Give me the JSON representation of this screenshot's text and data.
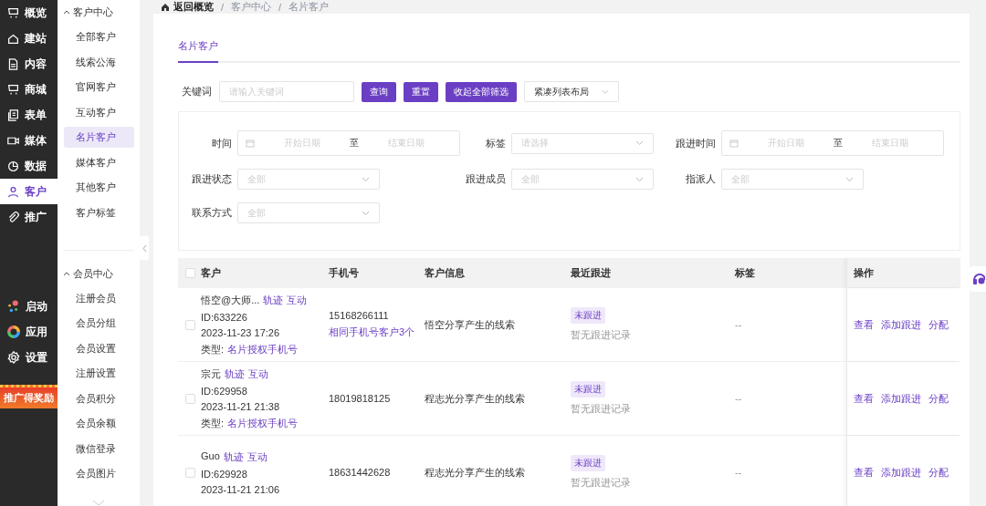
{
  "rail": {
    "items": [
      {
        "label": "概览",
        "selected": false
      },
      {
        "label": "建站",
        "selected": false
      },
      {
        "label": "内容",
        "selected": false
      },
      {
        "label": "商城",
        "selected": false
      },
      {
        "label": "表单",
        "selected": false
      },
      {
        "label": "媒体",
        "selected": false
      },
      {
        "label": "数据",
        "selected": false
      },
      {
        "label": "客户",
        "selected": true
      },
      {
        "label": "推广",
        "selected": false
      }
    ],
    "bottom_items": [
      "启动",
      "应用",
      "设置"
    ],
    "promo": "推广得奖励"
  },
  "subnav": {
    "groups": [
      {
        "title": "客户中心",
        "expanded": true,
        "items": [
          {
            "label": "全部客户",
            "selected": false
          },
          {
            "label": "线索公海",
            "selected": false
          },
          {
            "label": "官网客户",
            "selected": false
          },
          {
            "label": "互动客户",
            "selected": false
          },
          {
            "label": "名片客户",
            "selected": true
          },
          {
            "label": "媒体客户",
            "selected": false
          },
          {
            "label": "其他客户",
            "selected": false
          },
          {
            "label": "客户标签",
            "selected": false
          }
        ]
      },
      {
        "title": "会员中心",
        "expanded": true,
        "items": [
          {
            "label": "注册会员",
            "selected": false
          },
          {
            "label": "会员分组",
            "selected": false
          },
          {
            "label": "会员设置",
            "selected": false
          },
          {
            "label": "注册设置",
            "selected": false
          },
          {
            "label": "会员积分",
            "selected": false
          },
          {
            "label": "会员余额",
            "selected": false
          },
          {
            "label": "微信登录",
            "selected": false
          },
          {
            "label": "会员图片",
            "selected": false
          }
        ]
      }
    ]
  },
  "breadcrumb": [
    {
      "label": "返回概览"
    },
    {
      "sep": "/",
      "label": "客户中心"
    },
    {
      "sep": "/",
      "label": "名片客户"
    }
  ],
  "tabs": [
    {
      "label": "名片客户",
      "selected": true
    }
  ],
  "search": {
    "label": "关键词",
    "placeholder": "请输入关键词",
    "buttons": [
      "查询",
      "重置",
      "收起全部筛选"
    ],
    "layout": "紧凑列表布局"
  },
  "filters": [
    {
      "kind": "date_range",
      "label": "时间",
      "start": "开始日期",
      "sep": "至",
      "end": "结束日期"
    },
    {
      "kind": "select",
      "label": "标签",
      "placeholder": "请选择"
    },
    {
      "kind": "date_range",
      "label": "跟进时间",
      "start": "开始日期",
      "sep": "至",
      "end": "结束日期"
    },
    {
      "kind": "select",
      "label": "跟进状态",
      "placeholder": "全部"
    },
    {
      "kind": "select",
      "label": "跟进成员",
      "placeholder": "全部"
    },
    {
      "kind": "select",
      "label": "指派人",
      "placeholder": "全部"
    },
    {
      "kind": "select",
      "label": "联系方式",
      "placeholder": "全部"
    }
  ],
  "table": {
    "all_checked": false,
    "columns": [
      "客户",
      "手机号",
      "客户信息",
      "最近跟进",
      "标签",
      "操作"
    ],
    "rows": [
      {
        "checked": false,
        "name": "悟空@大师...",
        "links": [
          "轨迹",
          "互动"
        ],
        "id": "ID:633226",
        "time": "2023-11-23 17:26",
        "type_label": "类型:",
        "type": "名片授权手机号",
        "phone": "15168266111",
        "phone_link": "相同手机号客户3个",
        "info": "悟空分享产生的线索",
        "status": "未跟进",
        "note": "暂无跟进记录",
        "tags": "--",
        "actions": [
          "查看",
          "添加跟进",
          "分配"
        ]
      },
      {
        "checked": false,
        "name": "宗元",
        "links": [
          "轨迹",
          "互动"
        ],
        "id": "ID:629958",
        "time": "2023-11-21 21:38",
        "type_label": "类型:",
        "type": "名片授权手机号",
        "phone": "18019818125",
        "info": "程志光分享产生的线索",
        "status": "未跟进",
        "note": "暂无跟进记录",
        "tags": "--",
        "actions": [
          "查看",
          "添加跟进",
          "分配"
        ]
      },
      {
        "checked": false,
        "name": "Guo",
        "links": [
          "轨迹",
          "互动"
        ],
        "id": "ID:629928",
        "time": "2023-11-21 21:06",
        "phone": "18631442628",
        "info": "程志光分享产生的线索",
        "status": "未跟进",
        "note": "暂无跟进记录",
        "tags": "--",
        "actions": [
          "查看",
          "添加跟进",
          "分配"
        ]
      }
    ]
  }
}
